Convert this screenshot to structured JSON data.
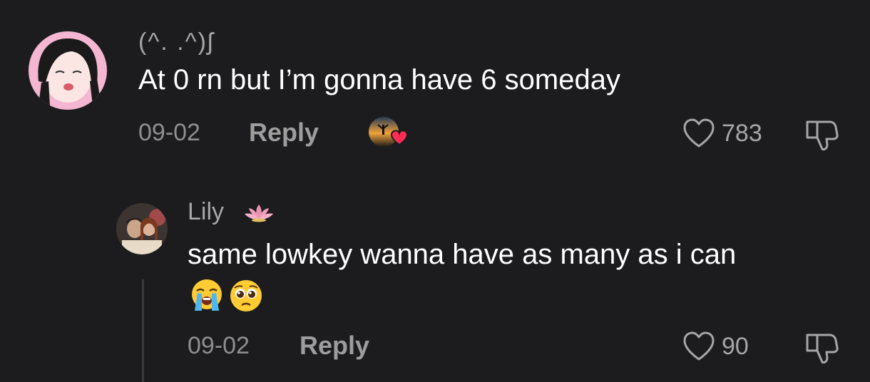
{
  "comment": {
    "username": "(^. .^)ʃ",
    "text": "At 0 rn but I’m gonna have 6 someday",
    "date": "09-02",
    "reply_label": "Reply",
    "likes": "783"
  },
  "reply": {
    "username": "Lily",
    "username_emoji": "lotus-icon",
    "text": "same lowkey wanna have as many as i can",
    "emojis": [
      "loudly-crying-face-icon",
      "pleading-face-icon"
    ],
    "date": "09-02",
    "reply_label": "Reply",
    "likes": "90"
  },
  "colors": {
    "background": "#1c1c1e",
    "primary_text": "#ffffff",
    "secondary_text": "#8e8e8e",
    "like_heart": "#ff2d55"
  }
}
